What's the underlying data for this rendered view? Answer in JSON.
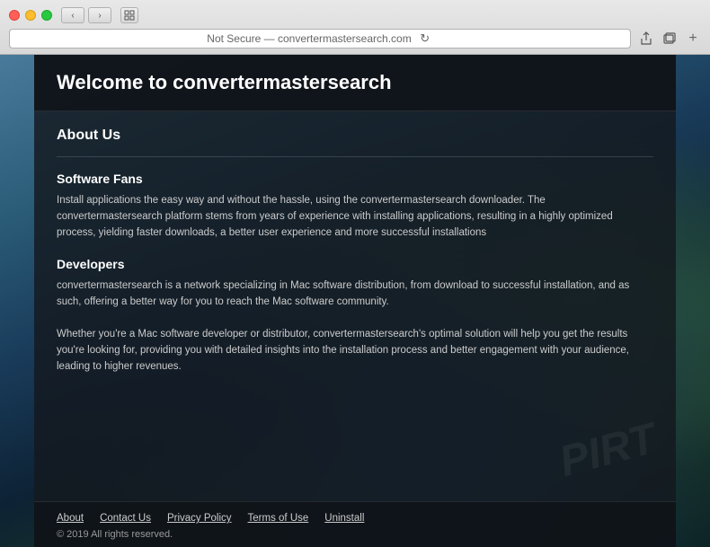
{
  "browser": {
    "status": "Not Secure — convertermastersearch.com",
    "nav": {
      "back": "‹",
      "forward": "›"
    }
  },
  "header": {
    "title": "Welcome to convertermastersearch"
  },
  "sections": [
    {
      "id": "about-us",
      "heading": "About Us"
    },
    {
      "id": "software-fans",
      "subheading": "Software Fans",
      "text": "Install applications the easy way and without the hassle, using the convertermastersearch downloader. The convertermastersearch platform stems from years of experience with installing applications, resulting in a highly optimized process, yielding faster downloads, a better user experience and more successful installations"
    },
    {
      "id": "developers",
      "subheading": "Developers",
      "text1": "convertermastersearch is a network specializing in Mac software distribution, from download to successful installation, and as such, offering a better way for you to reach the Mac software community.",
      "text2": "Whether you're a Mac software developer or distributor, convertermastersearch's optimal solution will help you get the results you're looking for, providing you with detailed insights into the installation process and better engagement with your audience, leading to higher revenues."
    }
  ],
  "footer": {
    "links": [
      {
        "label": "About",
        "id": "about-link"
      },
      {
        "label": "Contact Us",
        "id": "contact-link"
      },
      {
        "label": "Privacy Policy",
        "id": "privacy-link"
      },
      {
        "label": "Terms of Use",
        "id": "terms-link"
      },
      {
        "label": "Uninstall",
        "id": "uninstall-link"
      }
    ],
    "copyright": "© 2019 All rights reserved."
  }
}
